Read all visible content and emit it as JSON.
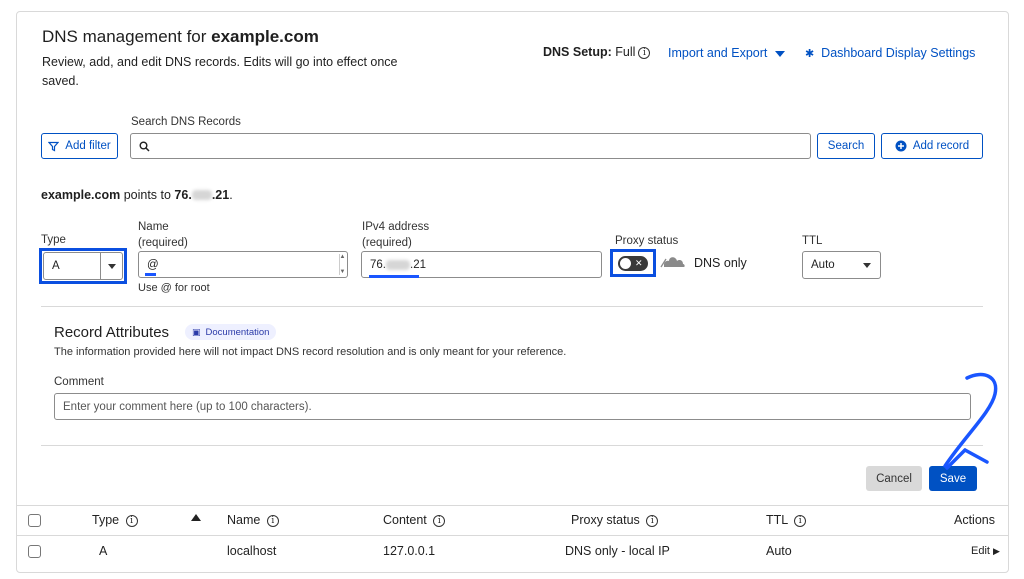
{
  "header": {
    "title_prefix": "DNS management for ",
    "title_domain": "example.com",
    "subtitle": "Review, add, and edit DNS records. Edits will go into effect once saved.",
    "dns_setup_label": "DNS Setup:",
    "dns_setup_value": "Full",
    "import_export": "Import and Export",
    "dashboard_settings": "Dashboard Display Settings"
  },
  "toolbar": {
    "search_label": "Search DNS Records",
    "add_filter": "Add filter",
    "search_button": "Search",
    "add_record": "Add record",
    "search_placeholder": ""
  },
  "points_to": {
    "domain": "example.com",
    "text": " points to ",
    "ip_prefix": "76.",
    "ip_suffix": ".21",
    "end": "."
  },
  "form": {
    "type_label": "Type",
    "type_value": "A",
    "name_label": "Name",
    "name_sub": "(required)",
    "name_value": "@",
    "name_hint": "Use @ for root",
    "ipv4_label": "IPv4 address",
    "ipv4_sub": "(required)",
    "ipv4_prefix": "76.",
    "ipv4_suffix": ".21",
    "proxy_label": "Proxy status",
    "proxy_value": "DNS only",
    "ttl_label": "TTL",
    "ttl_value": "Auto"
  },
  "attributes": {
    "title": "Record Attributes",
    "doc_badge": "Documentation",
    "description": "The information provided here will not impact DNS record resolution and is only meant for your reference.",
    "comment_label": "Comment",
    "comment_placeholder": "Enter your comment here (up to 100 characters)."
  },
  "actions": {
    "cancel": "Cancel",
    "save": "Save"
  },
  "table": {
    "columns": [
      "Type",
      "Name",
      "Content",
      "Proxy status",
      "TTL",
      "Actions"
    ],
    "rows": [
      {
        "type": "A",
        "name": "localhost",
        "content": "127.0.0.1",
        "proxy": "DNS only - local IP",
        "ttl": "Auto",
        "action": "Edit"
      }
    ]
  },
  "colors": {
    "link": "#0051c3",
    "highlight": "#0b4fe0",
    "save_button": "#0051c3"
  }
}
